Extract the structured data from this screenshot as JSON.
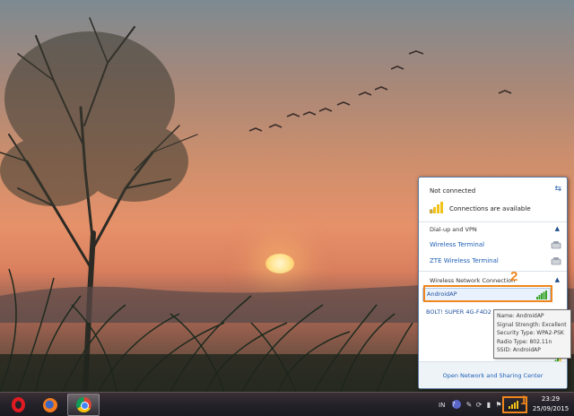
{
  "flyout": {
    "status": "Not connected",
    "available": "Connections are available",
    "dialup_title": "Dial-up and VPN",
    "dialup_items": [
      {
        "label": "Wireless Terminal"
      },
      {
        "label": "ZTE Wireless Terminal"
      }
    ],
    "wireless_title": "Wireless Network Connection",
    "wifi_items": [
      {
        "label": "AndroidAP"
      },
      {
        "label": "BOLT! SUPER 4G-F4D2"
      }
    ],
    "footer": "Open Network and Sharing Center"
  },
  "tooltip": {
    "name": "Name: AndroidAP",
    "signal": "Signal Strength: Excellent",
    "security": "Security Type: WPA2-PSK",
    "radio": "Radio Type: 802.11n",
    "ssid": "SSID: AndroidAP"
  },
  "annotations": {
    "one": "1",
    "two": "2"
  },
  "taskbar": {
    "language": "IN",
    "help": "?",
    "time": "23:29",
    "date": "25/09/2015"
  },
  "colors": {
    "highlight": "#f0861c",
    "link": "#1f5fb4"
  }
}
